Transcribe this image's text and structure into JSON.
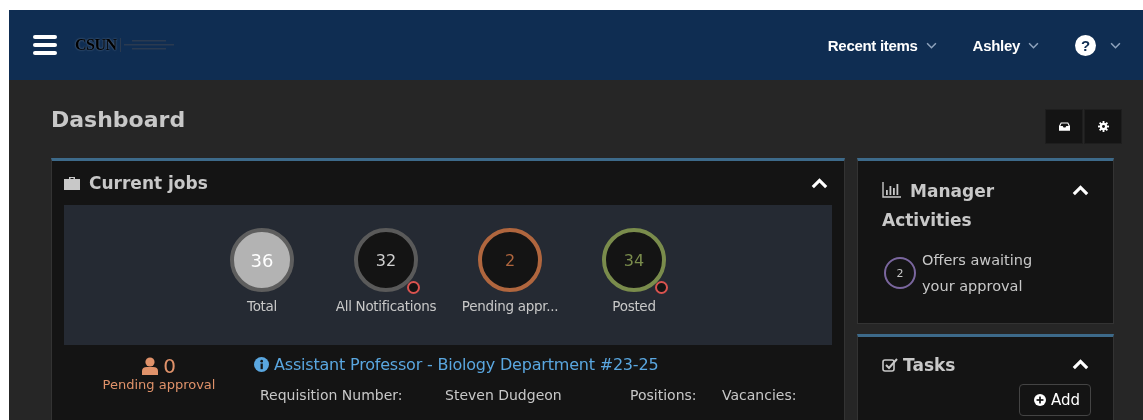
{
  "navbar": {
    "logo": "CSUN",
    "menus": [
      {
        "label": "Recent items"
      },
      {
        "label": "Ashley"
      }
    ],
    "help": "?"
  },
  "page": {
    "title": "Dashboard"
  },
  "current_jobs": {
    "title": "Current jobs",
    "stats": [
      {
        "value": "36",
        "label": "Total",
        "kind": "solid",
        "color": "#b3b3b3",
        "alert": false
      },
      {
        "value": "32",
        "label": "All Notifications",
        "kind": "ring",
        "color": "#5a5a5a",
        "alert": true
      },
      {
        "value": "2",
        "label": "Pending appr...",
        "kind": "ring",
        "color": "#b0663e",
        "alert": false
      },
      {
        "value": "34",
        "label": "Posted",
        "kind": "ring",
        "color": "#7a8c4c",
        "alert": true
      }
    ],
    "jobs": [
      {
        "count": "0",
        "status": "Pending approval",
        "title": "Assistant Professor - Biology Department #23-25",
        "fields": [
          "Requisition Number:",
          "Steven Dudgeon",
          "Positions:",
          "Vacancies:"
        ]
      }
    ]
  },
  "manager_activities": {
    "title": "Manager Activities",
    "items": [
      {
        "count": "2",
        "text": "Offers awaiting your approval"
      }
    ]
  },
  "tasks": {
    "title": "Tasks",
    "button": "Add"
  }
}
